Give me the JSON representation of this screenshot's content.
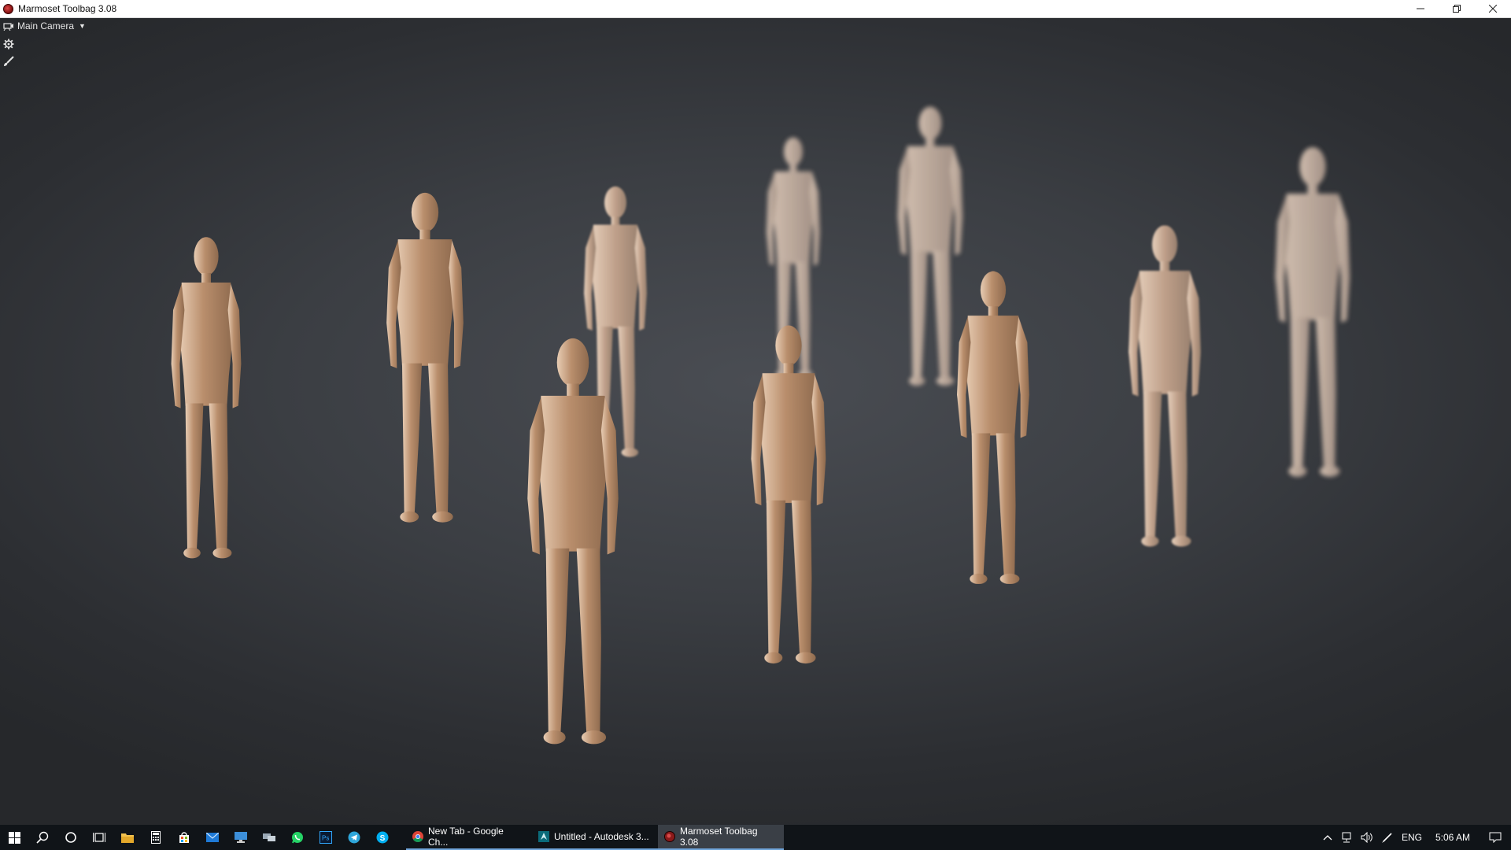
{
  "window": {
    "title": "Marmoset Toolbag 3.08",
    "controls": [
      "minimize-icon",
      "restore-icon",
      "close-icon"
    ]
  },
  "viewport": {
    "camera_label": "Main Camera",
    "tools": [
      "camera-icon",
      "gear-icon",
      "paint-brush-icon"
    ],
    "background_color": "#3b3e43",
    "figure_color": "#b98e6c"
  },
  "taskbar": {
    "pinned": [
      "windows-start-icon",
      "search-icon",
      "cortana-icon",
      "task-view-icon",
      "file-explorer-icon",
      "calculator-icon",
      "store-icon",
      "mail-icon",
      "remote-desktop-icon",
      "network-tool-icon",
      "whatsapp-icon",
      "photoshop-icon",
      "telegram-icon",
      "skype-icon"
    ],
    "tasks": [
      {
        "label": "New Tab - Google Ch...",
        "icon": "chrome-icon"
      },
      {
        "label": "Untitled - Autodesk 3...",
        "icon": "autodesk-3dsmax-icon"
      },
      {
        "label": "Marmoset Toolbag 3.08",
        "icon": "marmoset-icon",
        "active": true
      }
    ],
    "tray": {
      "language": "ENG",
      "time": "5:06 AM"
    }
  }
}
